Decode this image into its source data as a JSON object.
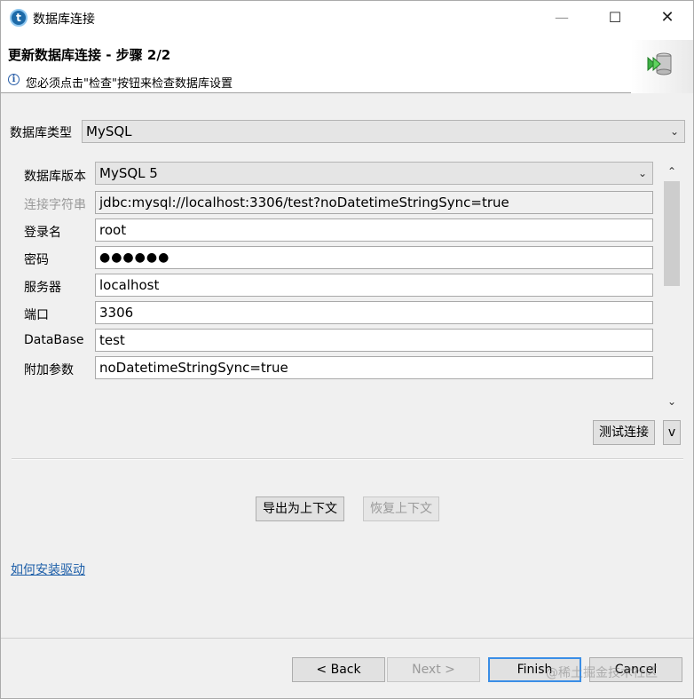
{
  "window": {
    "title": "数据库连接",
    "app_icon_glyph": "t",
    "controls": {
      "minimize": "—",
      "maximize": "☐",
      "close": "✕"
    }
  },
  "header": {
    "title": "更新数据库连接 - 步骤 2/2",
    "message": "您必须点击\"检查\"按钮来检查数据库设置"
  },
  "db_type": {
    "label": "数据库类型",
    "value": "MySQL"
  },
  "form": {
    "version": {
      "label": "数据库版本",
      "value": "MySQL 5"
    },
    "connection_string": {
      "label": "连接字符串",
      "value": "jdbc:mysql://localhost:3306/test?noDatetimeStringSync=true"
    },
    "login": {
      "label": "登录名",
      "value": "root"
    },
    "password": {
      "label": "密码",
      "value": "●●●●●●"
    },
    "server": {
      "label": "服务器",
      "value": "localhost"
    },
    "port": {
      "label": "端口",
      "value": "3306"
    },
    "database": {
      "label": "DataBase",
      "value": "test"
    },
    "extra_params": {
      "label": "附加参数",
      "value": "noDatetimeStringSync=true"
    }
  },
  "buttons": {
    "test_connection": "测试连接",
    "test_menu": "v",
    "export_context": "导出为上下文",
    "restore_context": "恢复上下文",
    "back": "< Back",
    "next": "Next >",
    "finish": "Finish",
    "cancel": "Cancel"
  },
  "link": {
    "install_driver": "如何安装驱动"
  },
  "watermark": "@稀土掘金技术社区",
  "colors": {
    "link": "#1c5ea8",
    "default_button_border": "#3a8ee6",
    "disabled_text": "#9a9a9a"
  }
}
